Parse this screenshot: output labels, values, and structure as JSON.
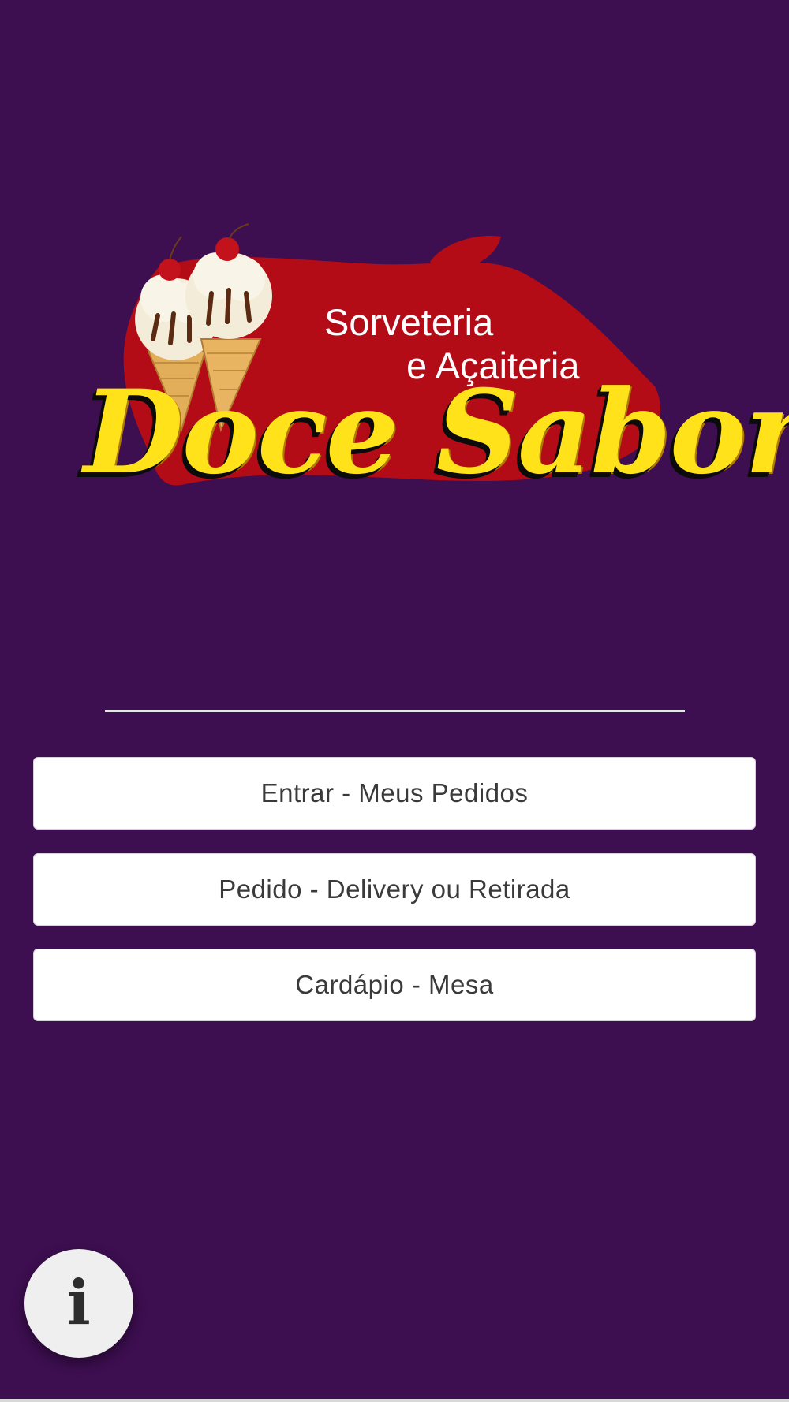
{
  "brand": {
    "subtitle_line1": "Sorveteria",
    "subtitle_line2": "e Açaiteria",
    "name": "Doce Sabor"
  },
  "menu": {
    "items": [
      {
        "label": "Entrar - Meus Pedidos"
      },
      {
        "label": "Pedido - Delivery ou Retirada"
      },
      {
        "label": "Cardápio - Mesa"
      }
    ]
  },
  "info_button": {
    "glyph": "i",
    "icon": "info-icon"
  },
  "colors": {
    "background": "#3d0e50",
    "logo_red": "#b30c17",
    "logo_yellow": "#ffe21a",
    "button_bg": "#ffffff",
    "button_text": "#3a3a3a"
  }
}
